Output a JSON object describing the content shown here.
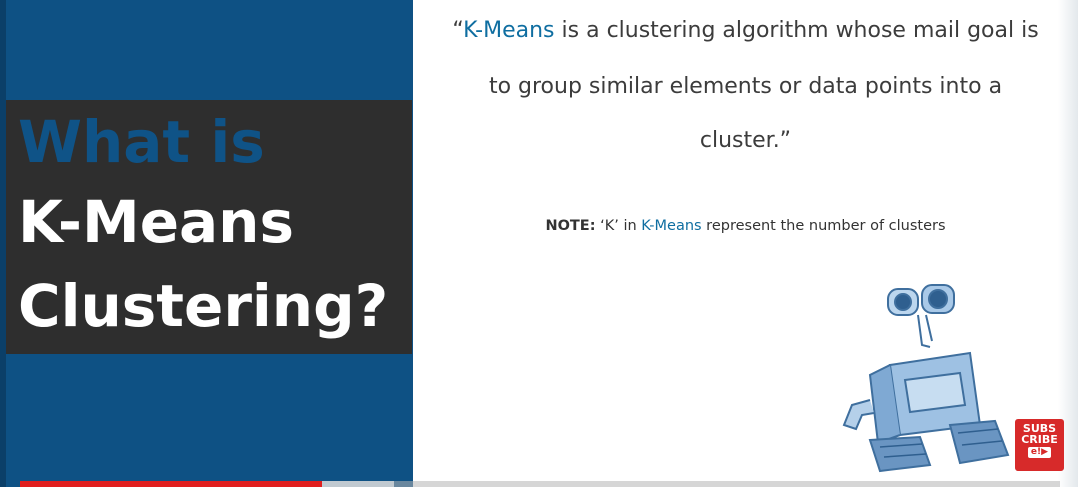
{
  "slide": {
    "title_line1": "What is",
    "title_line2": "K-Means",
    "title_line3": "Clustering?",
    "quote": {
      "open": "“",
      "term": "K-Means",
      "line1_rest": " is a clustering algorithm whose mail goal is",
      "line2": "to group similar elements or data points into a",
      "line3": "cluster.”"
    },
    "note": {
      "label": "NOTE:",
      "pre": " ‘K’ in ",
      "term": "K-Means",
      "post": " represent the number of clusters"
    },
    "robot_icon": "robot-illustration-icon"
  },
  "subscribe": {
    "line1": "SUBS",
    "line2": "CRIBE",
    "logo": "e!",
    "play": "▶"
  },
  "player": {
    "progress": 0.29,
    "buffered": 0.36
  },
  "colors": {
    "accent_blue": "#0f5387",
    "panel_blue": "#0e5184",
    "dark_box": "#2e2e2e",
    "link_blue": "#0f6ea1",
    "progress_red": "#e01e1e"
  }
}
